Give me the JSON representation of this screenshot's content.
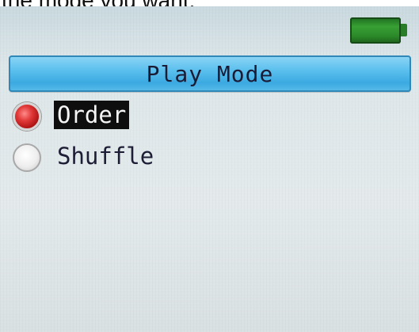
{
  "caption": "the mode you want.",
  "header": {
    "title": "Play Mode"
  },
  "menu": {
    "options": [
      {
        "label": "Order",
        "selected": true
      },
      {
        "label": "Shuffle",
        "selected": false
      }
    ]
  },
  "icons": {
    "battery": "battery-full-icon",
    "radio_on": "radio-selected-icon",
    "radio_off": "radio-unselected-icon"
  },
  "colors": {
    "title_bar": "#5cc0ee",
    "battery": "#37a033",
    "radio_on": "#e23a3a",
    "selection_bg": "#0e0e0e"
  }
}
